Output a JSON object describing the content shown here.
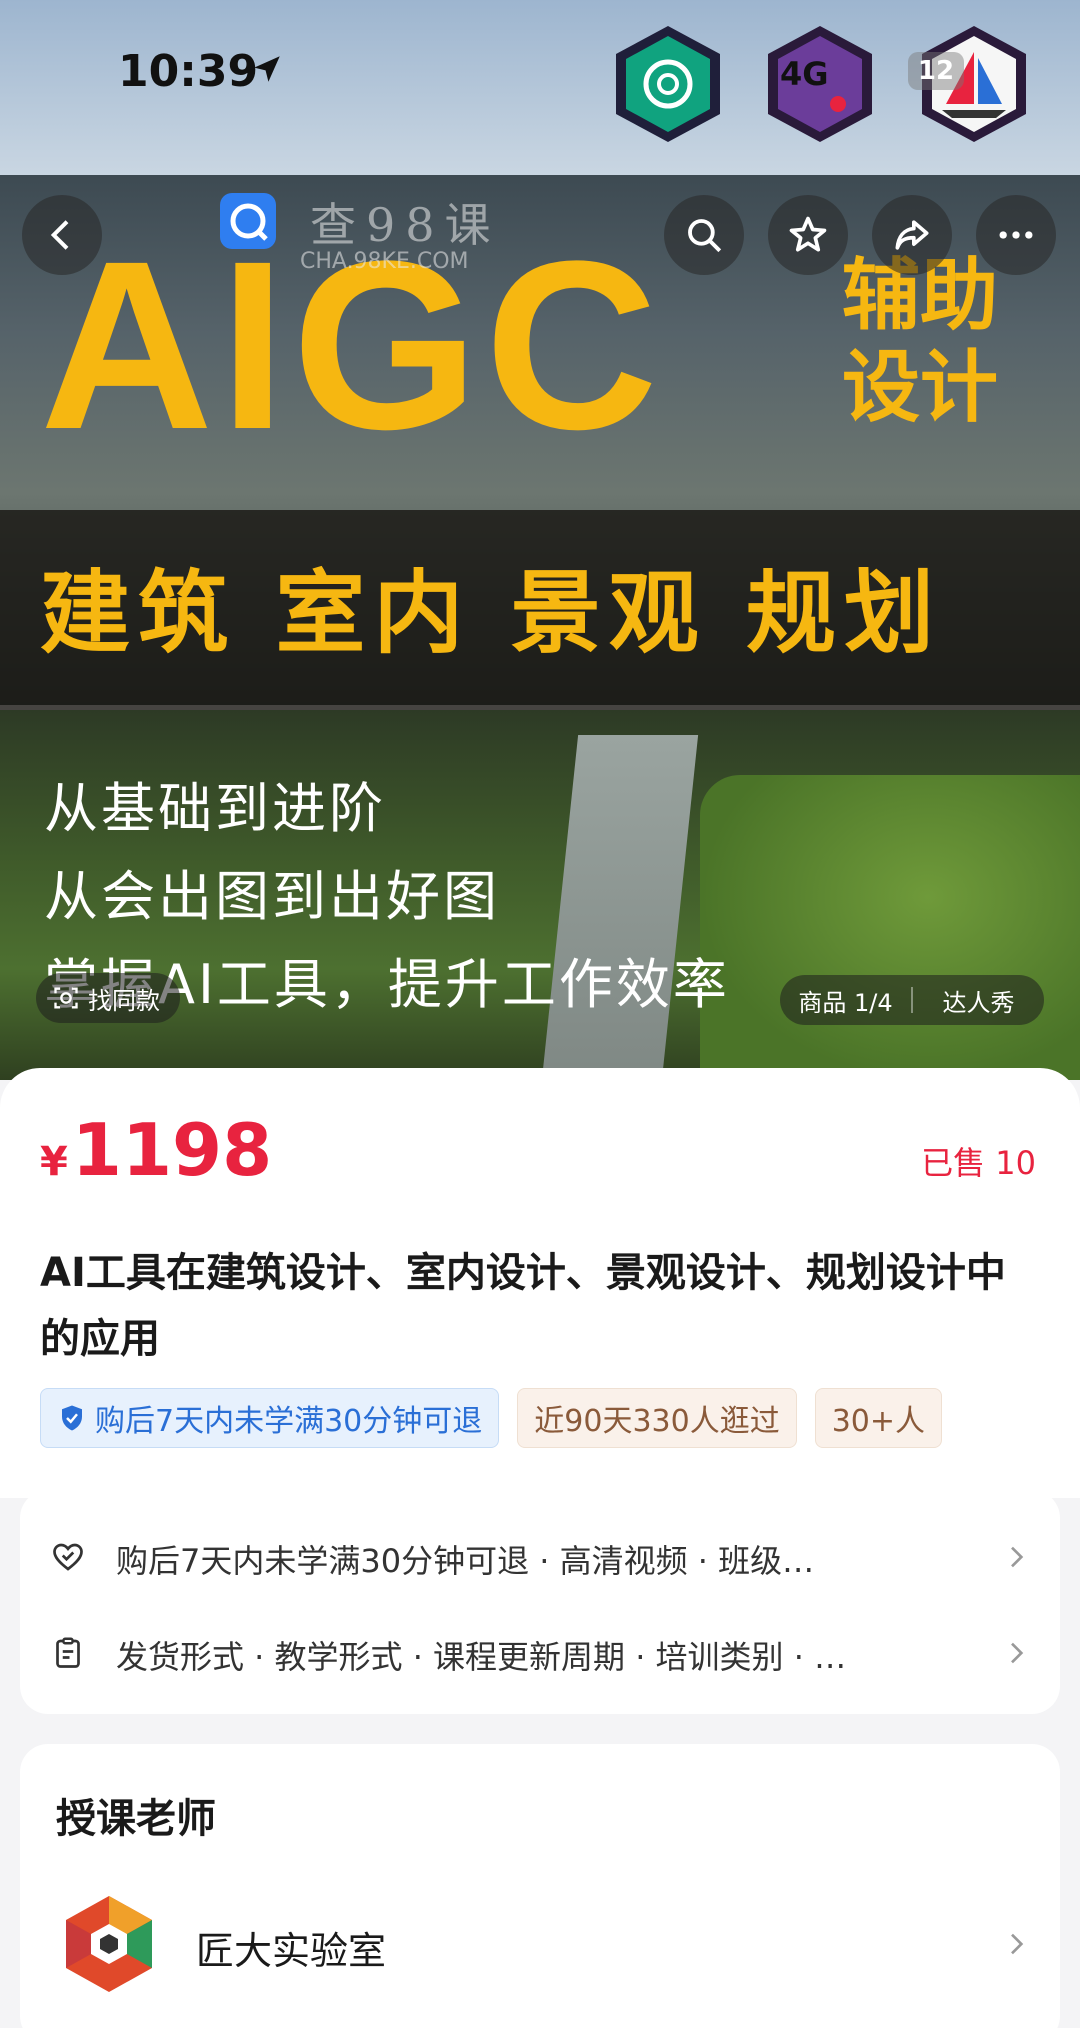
{
  "status_bar": {
    "time": "10:39",
    "network": "4G",
    "battery": "12",
    "app_icons": [
      "chatgpt-app-icon",
      "notification-app-icon",
      "sailboat-app-icon"
    ]
  },
  "hero": {
    "title": "AIGC",
    "title_side": "辅助设计",
    "subtitle": "建筑 室内 景观 规划",
    "lines": [
      "从基础到进阶",
      "从会出图到出好图",
      "掌握AI工具，提升工作效率"
    ],
    "watermark_text": "查98课",
    "watermark_url": "CHA.98KE.COM",
    "find_similar": "找同款",
    "image_counter": "商品 1/4",
    "showcase_label": "达人秀"
  },
  "product": {
    "currency": "¥",
    "price": "1198",
    "sold": "已售 10",
    "title": "AI工具在建筑设计、室内设计、景观设计、规划设计中的应用",
    "tags": [
      "购后7天内未学满30分钟可退",
      "近90天330人逛过",
      "30+人"
    ]
  },
  "services": [
    {
      "icon": "heart-shield-icon",
      "text": "购后7天内未学满30分钟可退 · 高清视频 · 班级…"
    },
    {
      "icon": "clipboard-icon",
      "text": "发货形式 · 教学形式 · 课程更新周期 · 培训类别 · …"
    }
  ],
  "teacher": {
    "heading": "授课老师",
    "name": "匠大实验室"
  },
  "colors": {
    "price_red": "#e8233f",
    "hero_yellow": "#f6b711",
    "refund_blue": "#2a6fd6"
  }
}
